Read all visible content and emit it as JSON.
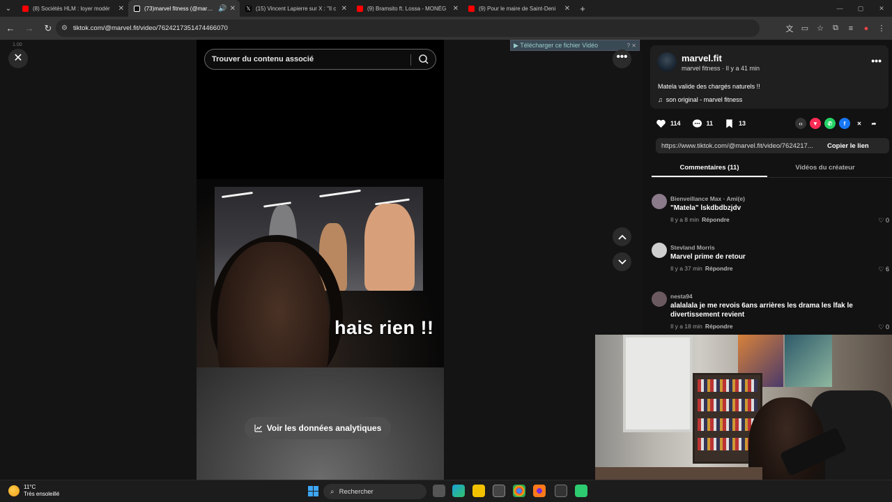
{
  "browser": {
    "tabs": [
      {
        "title": "(8) Sociétés HLM : loyer modér",
        "favicon_color": "#ff0000"
      },
      {
        "title": "(73)marvel fitness (@marvel.",
        "favicon_color": "#000000",
        "active": true
      },
      {
        "title": "(15) Vincent Lapierre sur X : \"Il c",
        "favicon_color": "#000000"
      },
      {
        "title": "(9) Bramsito ft. Lossa - MONÉG",
        "favicon_color": "#ff0000"
      },
      {
        "title": "(9) Pour le maire de Saint-Deni",
        "favicon_color": "#ff0000"
      }
    ],
    "url": "tiktok.com/@marvel.fit/video/7624217351474466070"
  },
  "video": {
    "search_placeholder": "Trouver du contenu associé",
    "overlay_text": "hais rien !!",
    "analytics_button": "Voir les données analytiques",
    "close_sub": "1.00"
  },
  "download_bar": {
    "label": "▶ Télécharger ce fichier Vidéo",
    "help": "? ✕"
  },
  "post": {
    "username": "marvel.fit",
    "subtitle": "marvel fitness · Il y a 41 min",
    "caption": "Matela valide des chargés naturels !!",
    "music": "son original - marvel fitness",
    "likes": "114",
    "comments": "11",
    "saves": "13",
    "link": "https://www.tiktok.com/@marvel.fit/video/7624217...",
    "copy_label": "Copier le lien"
  },
  "panel_tabs": [
    "Commentaires (11)",
    "Vidéos du créateur"
  ],
  "comments": [
    {
      "name": "Bienveillance Max · Ami(e)",
      "text": "\"Matela\" lskdbdbzjdv",
      "time": "Il y a 8 min",
      "reply": "Répondre",
      "likes": "0",
      "avatar_color": "#8a7a8a"
    },
    {
      "name": "Stevland Morris",
      "text": "Marvel prime de retour",
      "time": "Il y a 37 min",
      "reply": "Répondre",
      "likes": "6",
      "avatar_color": "#cfcfcf"
    },
    {
      "name": "nesta94",
      "text": "alalalala je me revois 6ans arrières les drama les lfak le divertissement revient",
      "time": "Il y a 18 min",
      "reply": "Répondre",
      "likes": "0",
      "avatar_color": "#6a5a60"
    }
  ],
  "taskbar": {
    "temp": "11°C",
    "weather": "Très ensoleillé",
    "search": "Rechercher"
  },
  "colors": {
    "accent_like": "#fe2c55",
    "analytics_bg": "#505050"
  }
}
